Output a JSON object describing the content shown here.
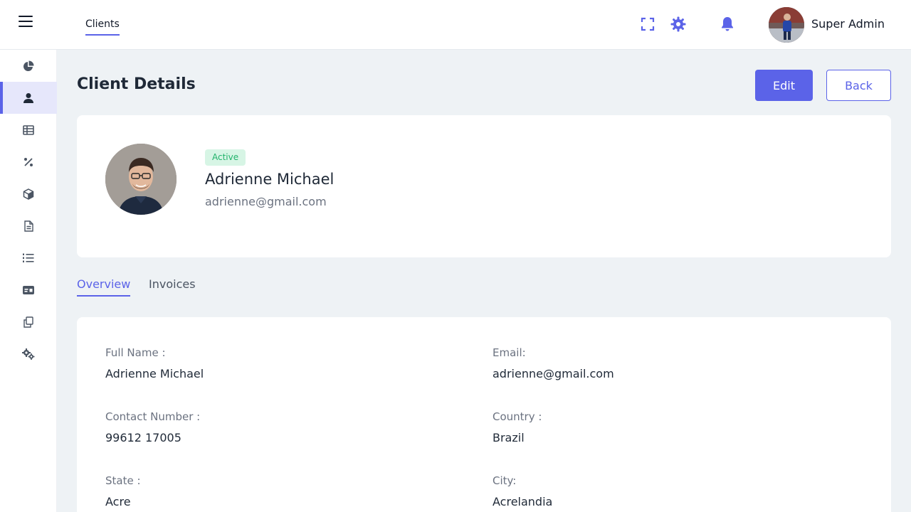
{
  "header": {
    "active_tab": "Clients",
    "user_name": "Super Admin",
    "accent_color": "#5b63e8"
  },
  "sidebar": {
    "items": [
      {
        "icon": "pie-chart-icon",
        "active": false
      },
      {
        "icon": "user-icon",
        "active": true
      },
      {
        "icon": "table-icon",
        "active": false
      },
      {
        "icon": "percent-icon",
        "active": false
      },
      {
        "icon": "box-icon",
        "active": false
      },
      {
        "icon": "document-icon",
        "active": false
      },
      {
        "icon": "list-icon",
        "active": false
      },
      {
        "icon": "id-card-icon",
        "active": false
      },
      {
        "icon": "copy-icon",
        "active": false
      },
      {
        "icon": "gears-icon",
        "active": false
      }
    ]
  },
  "page": {
    "title": "Client Details",
    "edit_label": "Edit",
    "back_label": "Back"
  },
  "profile": {
    "status": "Active",
    "name": "Adrienne Michael",
    "email": "adrienne@gmail.com"
  },
  "tabs": [
    {
      "label": "Overview",
      "active": true
    },
    {
      "label": "Invoices",
      "active": false
    }
  ],
  "details": {
    "full_name_label": "Full Name :",
    "full_name": "Adrienne Michael",
    "email_label": "Email:",
    "email": "adrienne@gmail.com",
    "contact_label": "Contact Number :",
    "contact": "99612 17005",
    "country_label": "Country :",
    "country": "Brazil",
    "state_label": "State :",
    "state": "Acre",
    "city_label": "City:",
    "city": "Acrelandia"
  }
}
